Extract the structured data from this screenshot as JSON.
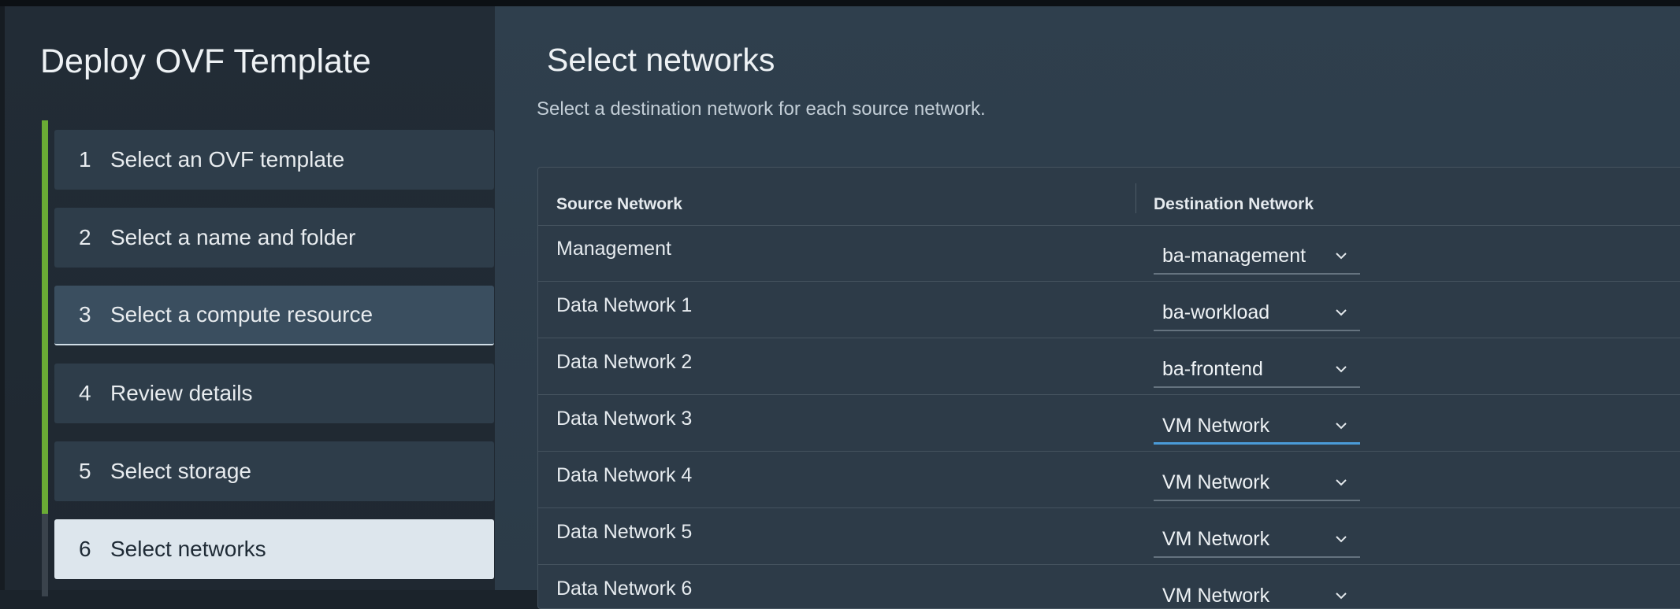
{
  "wizard": {
    "title": "Deploy OVF Template",
    "steps": [
      {
        "num": "1",
        "label": "Select an OVF template"
      },
      {
        "num": "2",
        "label": "Select a name and folder"
      },
      {
        "num": "3",
        "label": "Select a compute resource"
      },
      {
        "num": "4",
        "label": "Review details"
      },
      {
        "num": "5",
        "label": "Select storage"
      },
      {
        "num": "6",
        "label": "Select networks"
      }
    ],
    "active_step": 6,
    "hover_step": 3
  },
  "main": {
    "title": "Select networks",
    "subtitle": "Select a destination network for each source network."
  },
  "grid": {
    "columns": {
      "source": "Source Network",
      "destination": "Destination Network"
    },
    "rows": [
      {
        "source": "Management",
        "destination": "ba-management"
      },
      {
        "source": "Data Network 1",
        "destination": "ba-workload"
      },
      {
        "source": "Data Network 2",
        "destination": "ba-frontend"
      },
      {
        "source": "Data Network 3",
        "destination": "VM Network"
      },
      {
        "source": "Data Network 4",
        "destination": "VM Network"
      },
      {
        "source": "Data Network 5",
        "destination": "VM Network"
      },
      {
        "source": "Data Network 6",
        "destination": "VM Network"
      }
    ],
    "focused_row": 4
  },
  "colors": {
    "progress": "#6aab35",
    "focus_underline": "#4a9bd8",
    "active_step_bg": "#dde6ed"
  },
  "icons": {
    "dropdown": "chevron-down-icon"
  }
}
